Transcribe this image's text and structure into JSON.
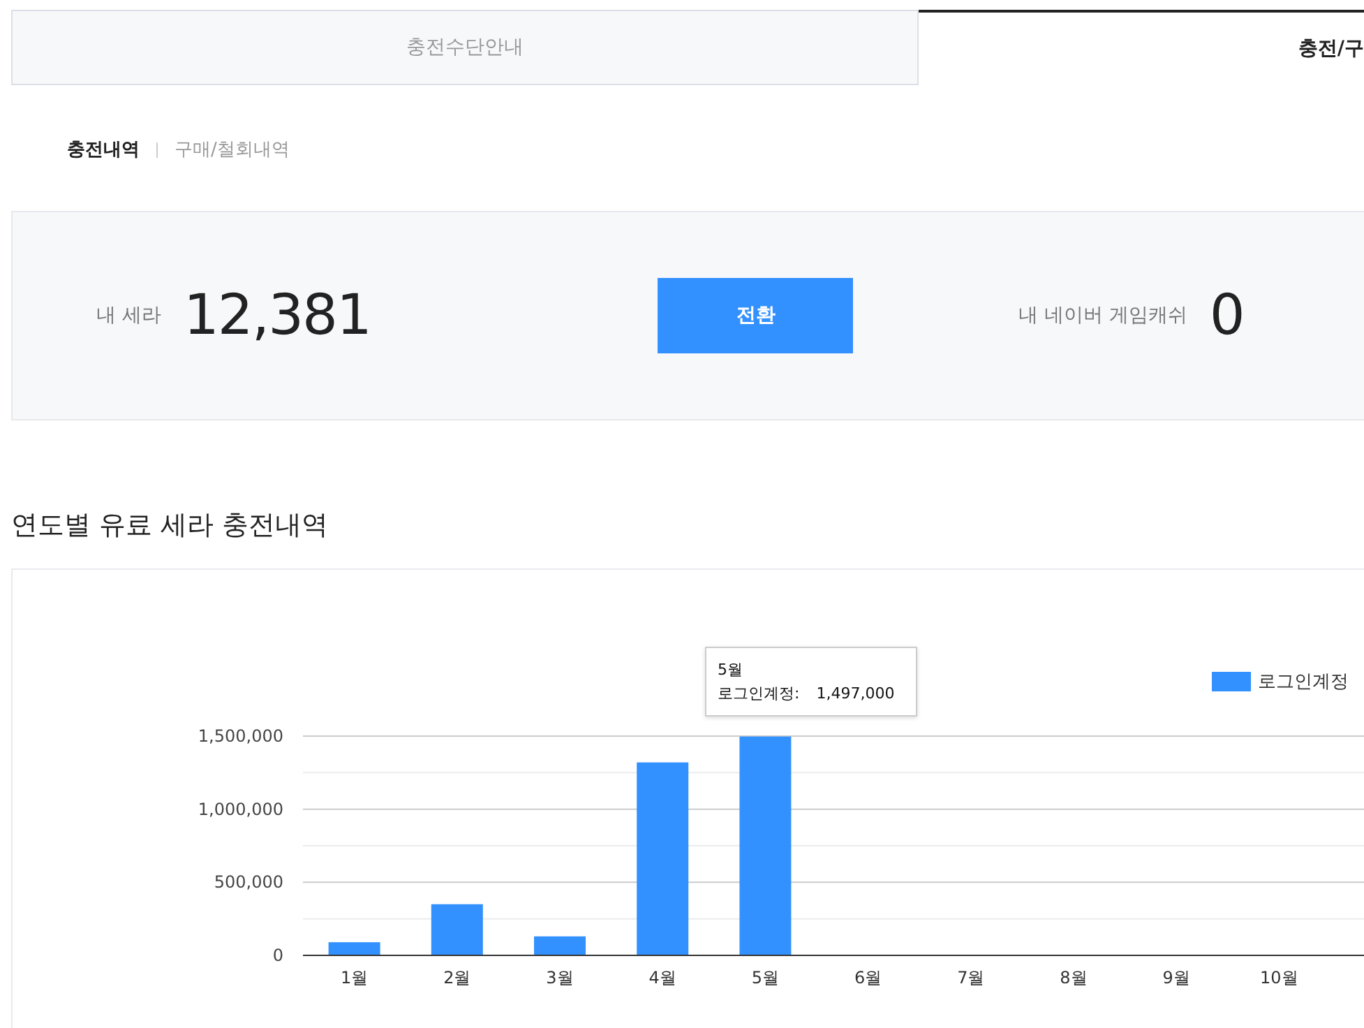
{
  "tabs": [
    {
      "label": "충전수단안내",
      "selected": false
    },
    {
      "label": "충전/구",
      "selected": true
    }
  ],
  "subtabs": [
    {
      "label": "충전내역",
      "selected": true
    },
    {
      "label": "구매/철회내역",
      "selected": false
    }
  ],
  "summary": {
    "sera_label": "내 세라",
    "sera_value": "12,381",
    "convert_button": "전환",
    "cash_label": "내 네이버 게임캐쉬",
    "cash_value": "0"
  },
  "chart_section": {
    "title": "연도별 유료 세라 충전내역",
    "tooltip": {
      "title": "5월",
      "label": "로그인계정:",
      "value": "1,497,000"
    },
    "chart_data": {
      "type": "bar",
      "categories": [
        "1월",
        "2월",
        "3월",
        "4월",
        "5월",
        "6월",
        "7월",
        "8월",
        "9월",
        "10월"
      ],
      "series": [
        {
          "name": "로그인계정",
          "color": "#3391ff",
          "values": [
            90000,
            350000,
            130000,
            1320000,
            1497000,
            0,
            0,
            0,
            0,
            0
          ]
        }
      ],
      "ylim": [
        0,
        1500000
      ],
      "yticks": [
        {
          "value": 0,
          "label": "0"
        },
        {
          "value": 500000,
          "label": "500,000"
        },
        {
          "value": 1000000,
          "label": "1,000,000"
        },
        {
          "value": 1500000,
          "label": "1,500,000"
        }
      ]
    }
  }
}
